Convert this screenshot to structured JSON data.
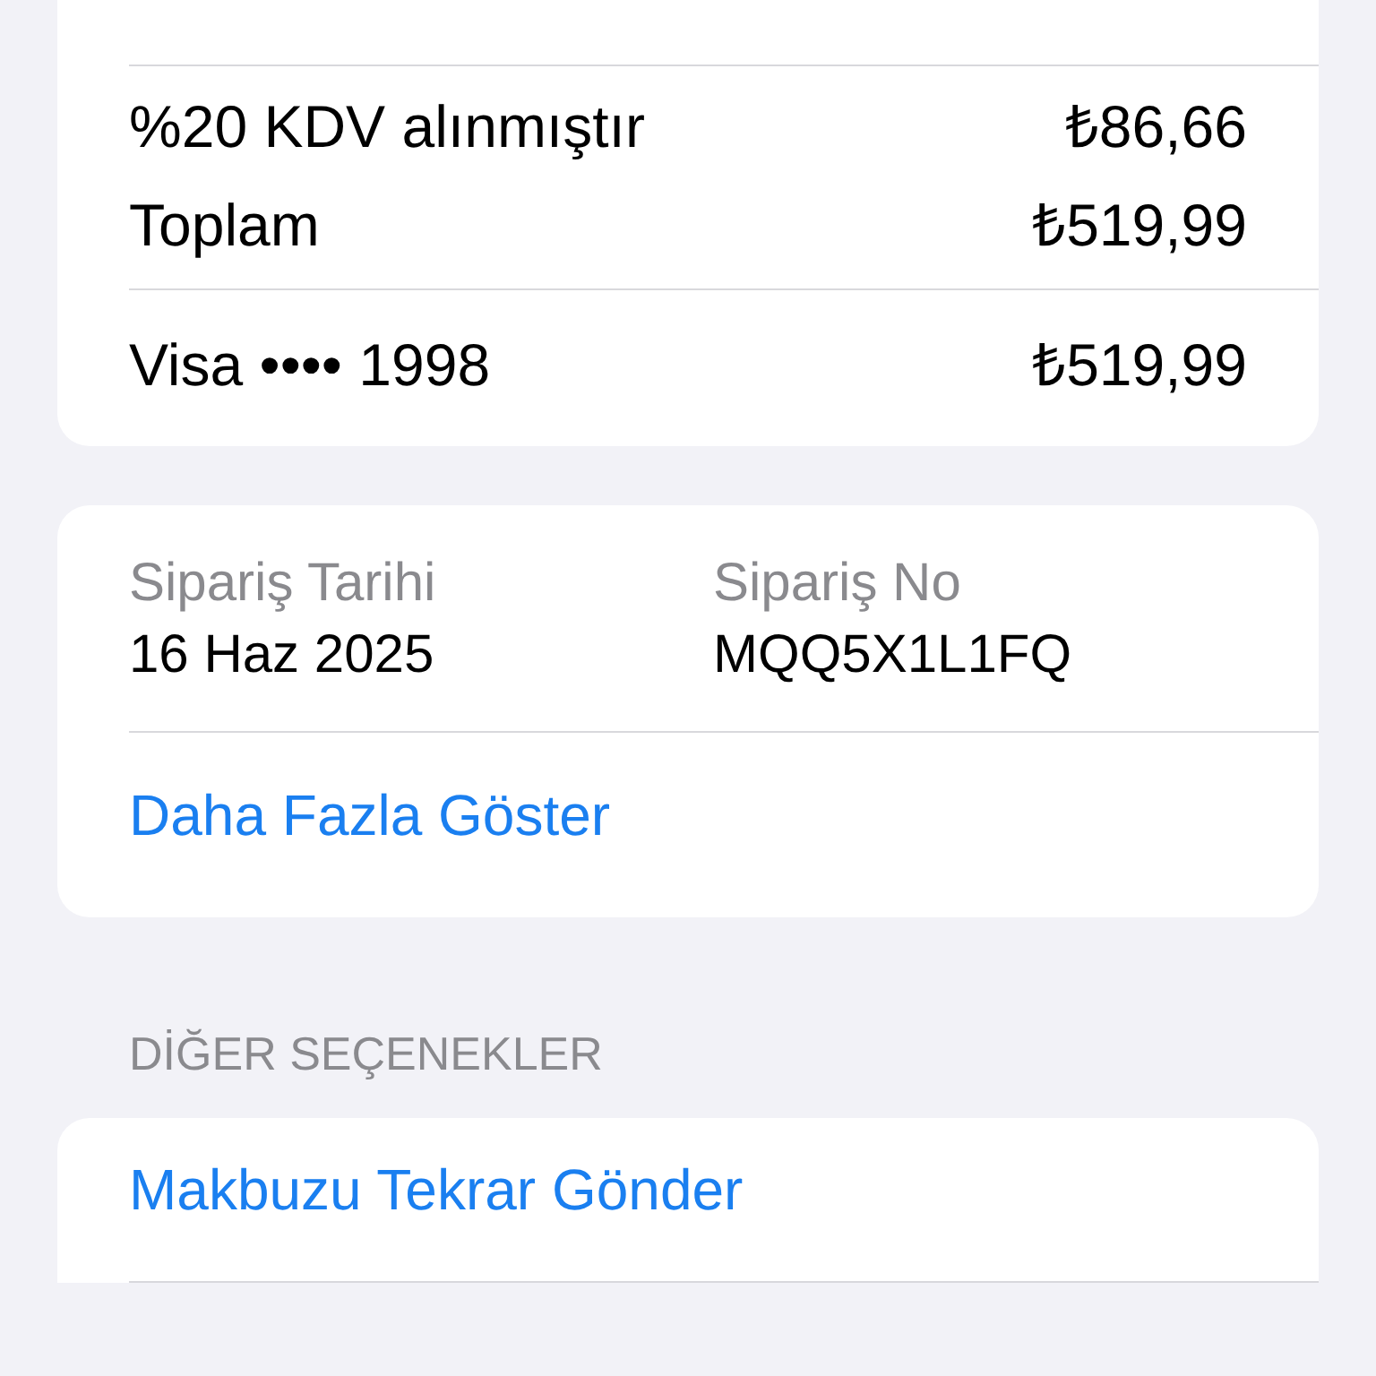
{
  "summary": {
    "lines": [
      {
        "label": "%20 KDV alınmıştır",
        "amount": "₺86,66"
      },
      {
        "label": "Toplam",
        "amount": "₺519,99"
      }
    ],
    "payment": {
      "label": "Visa •••• 1998",
      "amount": "₺519,99"
    }
  },
  "order": {
    "fields": [
      {
        "label": "Sipariş Tarihi",
        "value": "16 Haz 2025"
      },
      {
        "label": "Sipariş No",
        "value": "MQQ5X1L1FQ"
      }
    ],
    "link": "Daha Fazla Göster"
  },
  "other_options": {
    "header": "DİĞER SEÇENEKLER",
    "items": [
      "Makbuzu Tekrar Gönder"
    ]
  }
}
